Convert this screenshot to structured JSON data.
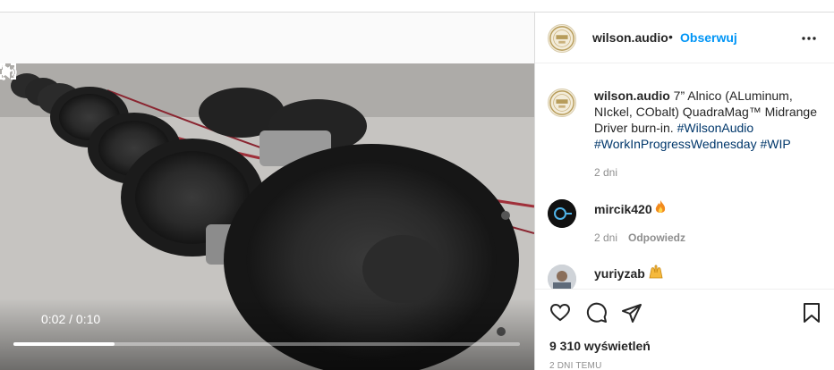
{
  "post": {
    "username": "wilson.audio",
    "separator": "•",
    "follow_label": "Obserwuj"
  },
  "caption": {
    "username": "wilson.audio",
    "text": "7” Alnico (ALuminum, NIckel, CObalt) QuadraMag™ Midrange Driver burn-in.",
    "hashtags": [
      "#WilsonAudio",
      "#WorkInProgressWednesday",
      "#WIP"
    ],
    "time": "2 dni"
  },
  "comments": [
    {
      "username": "mircik420",
      "emoji": "fire-emoji",
      "time": "2 dni",
      "reply_label": "Odpowiedz"
    },
    {
      "username": "yuriyzab",
      "emoji": "raised-hands-emoji"
    }
  ],
  "video": {
    "current_time": "0:02",
    "duration": "0:10",
    "time_separator": " / ",
    "progress": 0.2
  },
  "stats": {
    "views": "9 310 wyświetleń",
    "date": "2 DNI TEMU"
  },
  "colors": {
    "accent": "#0095f6",
    "hashtag": "#00376b",
    "text": "#262626",
    "muted": "#8e8e8e"
  },
  "icons": [
    "play-icon",
    "volume-icon",
    "fullscreen-icon",
    "video-more-icon",
    "more-options-icon",
    "like-icon",
    "comment-icon",
    "share-icon",
    "save-icon"
  ]
}
